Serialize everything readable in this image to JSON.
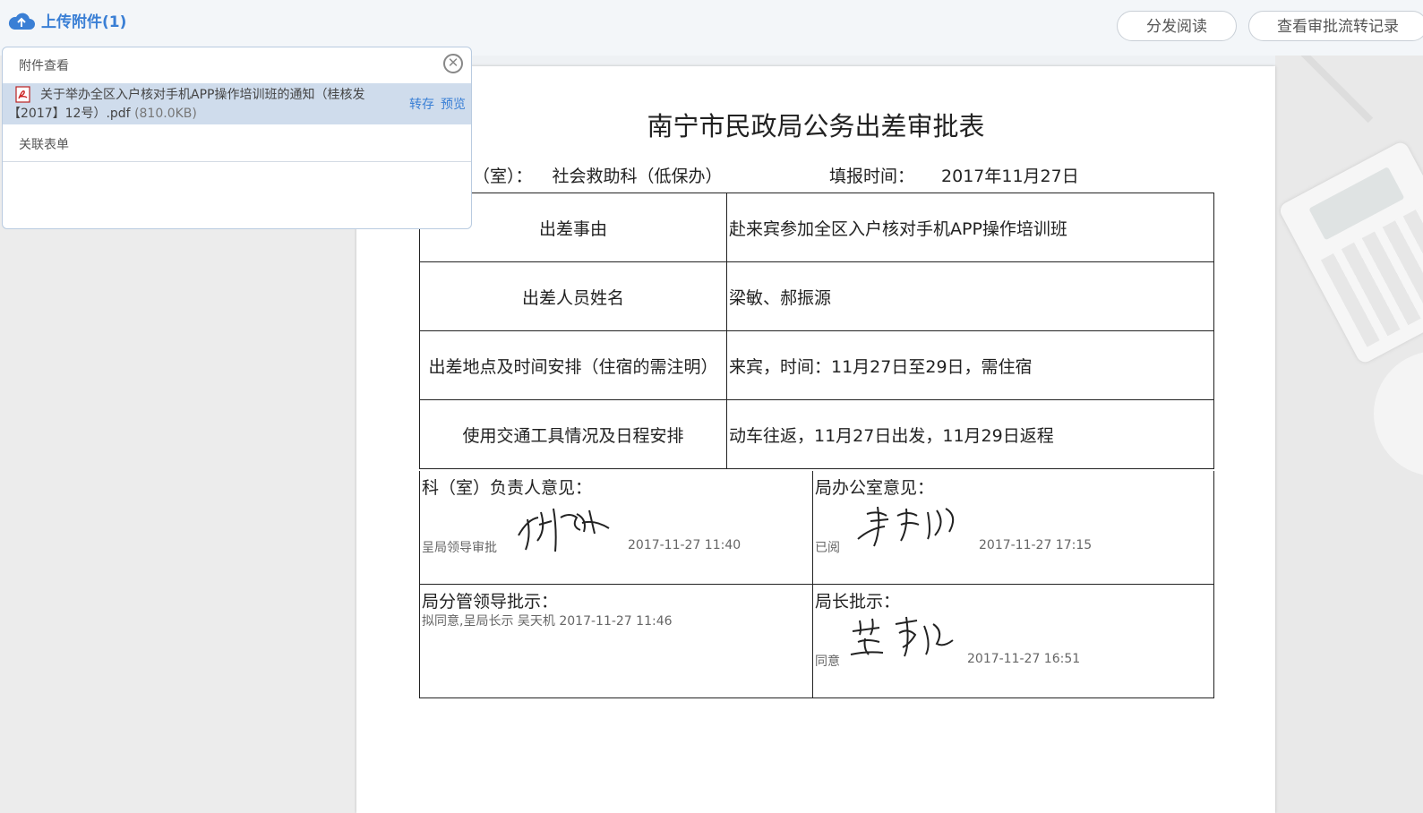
{
  "toolbar": {
    "upload_label": "上传附件(1)",
    "distribute_label": "分发阅读",
    "flow_label": "查看审批流转记录"
  },
  "attachment_popup": {
    "header": "附件查看",
    "file_name": "关于举办全区入户核对手机APP操作培训班的通知（桂核发【2017】12号）.pdf",
    "file_size": "(810.0KB)",
    "save_link": "转存",
    "preview_link": "预览",
    "related_form": "关联表单"
  },
  "document": {
    "title": "南宁市民政局公务出差审批表",
    "dept_label": "（室）：",
    "dept_value": "社会救助科（低保办）",
    "fill_label": "填报时间：",
    "fill_value": "2017年11月27日",
    "rows": [
      {
        "label": "出差事由",
        "value": "赴来宾参加全区入户核对手机APP操作培训班"
      },
      {
        "label": "出差人员姓名",
        "value": "梁敏、郝振源"
      },
      {
        "label": "出差地点及时间安排（住宿的需注明）",
        "value": "来宾，时间：11月27日至29日，需住宿"
      },
      {
        "label": "使用交通工具情况及日程安排",
        "value": "动车往返，11月27日出发，11月29日返程"
      }
    ],
    "opinions": {
      "section_head": {
        "title": "科（室）负责人意见：",
        "note": "呈局领导审批",
        "time": "2017-11-27 11:40"
      },
      "office": {
        "title": "局办公室意见：",
        "note": "已阅",
        "time": "2017-11-27 17:15"
      },
      "leader": {
        "title": "局分管领导批示：",
        "note": "拟同意,呈局长示 吴天机 2017-11-27 11:46"
      },
      "director": {
        "title": "局长批示：",
        "note": "同意",
        "time": "2017-11-27 16:51"
      }
    }
  },
  "colors": {
    "accent": "#3a7fd5",
    "popup_row": "#cfdcec"
  }
}
